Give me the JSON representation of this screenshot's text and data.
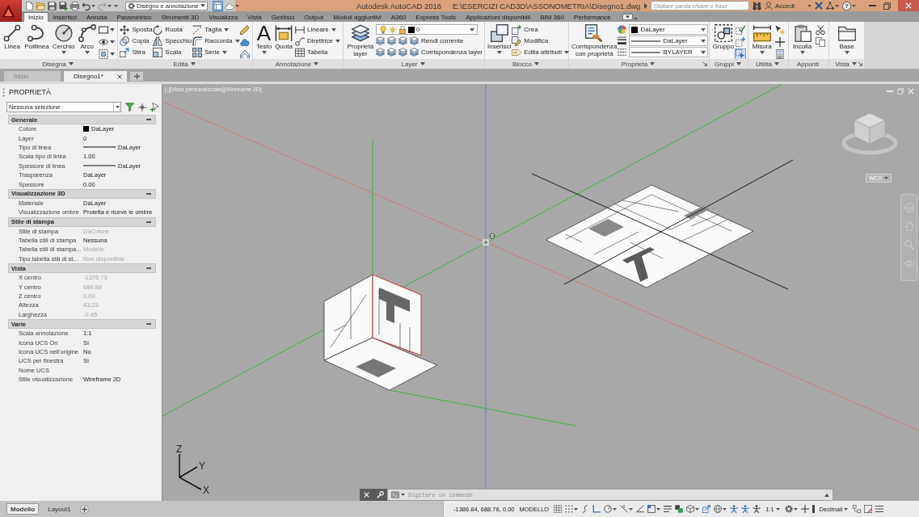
{
  "title_bar": {
    "workspace": "Disegno e annotazione",
    "app_name": "Autodesk AutoCAD 2016",
    "file_path": "E:\\ESERCIZI CAD3D\\ASSONOMETRIA\\Disegno1.dwg",
    "search": {
      "placeholder": "Digitare parola chiave o frase"
    },
    "user": "Accedi",
    "help_glyph": "?"
  },
  "ribbon": {
    "tabs": [
      {
        "label": "Inizio",
        "selected": true
      },
      {
        "label": "Inserisci",
        "selected": false
      },
      {
        "label": "Annota",
        "selected": false
      },
      {
        "label": "Parametrico",
        "selected": false
      },
      {
        "label": "Strumenti 3D",
        "selected": false
      },
      {
        "label": "Visualizza",
        "selected": false
      },
      {
        "label": "Vista",
        "selected": false
      },
      {
        "label": "Gestisci",
        "selected": false
      },
      {
        "label": "Output",
        "selected": false
      },
      {
        "label": "Moduli aggiuntivi",
        "selected": false
      },
      {
        "label": "A360",
        "selected": false
      },
      {
        "label": "Express Tools",
        "selected": false
      },
      {
        "label": "Applicazioni disponibili",
        "selected": false
      },
      {
        "label": "BIM 360",
        "selected": false
      },
      {
        "label": "Performance",
        "selected": false
      }
    ],
    "panels": [
      {
        "title": "Disegna",
        "menu": true,
        "launcher": false,
        "columns": [
          {
            "kind": "large",
            "label": "Linea",
            "menu": false
          },
          {
            "kind": "large",
            "label": "Polilinea",
            "menu": false
          },
          {
            "kind": "large",
            "label": "Cerchio",
            "menu": true
          },
          {
            "kind": "large",
            "label": "Arco",
            "menu": true
          },
          {
            "kind": "icons",
            "items": [
              {
                "menu": true,
                "on": false
              },
              {
                "menu": true,
                "on": false
              },
              {
                "menu": true,
                "on": false
              }
            ]
          }
        ]
      },
      {
        "title": "Edita",
        "menu": true,
        "launcher": false,
        "columns": [
          {
            "kind": "stack",
            "items": [
              {
                "label": "Sposta",
                "menu": false
              },
              {
                "label": "Copia",
                "menu": false
              },
              {
                "label": "Stira",
                "menu": false
              }
            ]
          },
          {
            "kind": "stack",
            "items": [
              {
                "label": "Ruota",
                "menu": false
              },
              {
                "label": "Specchio",
                "menu": false
              },
              {
                "label": "Scala",
                "menu": false
              }
            ]
          },
          {
            "kind": "stack",
            "items": [
              {
                "label": "Taglia",
                "menu": true
              },
              {
                "label": "Raccorda",
                "menu": true
              },
              {
                "label": "Serie",
                "menu": true
              }
            ]
          },
          {
            "kind": "icons",
            "items": [
              {
                "menu": false,
                "on": false
              },
              {
                "menu": false,
                "on": false
              },
              {
                "menu": false,
                "on": false
              }
            ]
          }
        ]
      },
      {
        "title": "Annotazione",
        "menu": true,
        "launcher": false,
        "columns": [
          {
            "kind": "large",
            "label": "Testo",
            "glyph": "A",
            "menu": true
          },
          {
            "kind": "large",
            "label": "Quota",
            "menu": false
          },
          {
            "kind": "stack",
            "items": [
              {
                "label": "Lineare",
                "menu": true
              },
              {
                "label": "Direttrice",
                "menu": true
              },
              {
                "label": "Tabella",
                "menu": false
              }
            ]
          }
        ]
      },
      {
        "title": "Layer",
        "menu": true,
        "launcher": false,
        "columns": [
          {
            "kind": "large",
            "label": "Proprietà layer",
            "menu": false
          },
          {
            "kind": "layer",
            "value": "0",
            "rows": [
              {
                "label": "Rendi corrente"
              },
              {
                "label": "Corrispondenza layer"
              }
            ]
          }
        ]
      },
      {
        "title": "Blocco",
        "menu": true,
        "launcher": false,
        "columns": [
          {
            "kind": "large",
            "label": "Inserisci",
            "menu": true
          },
          {
            "kind": "stack",
            "items": [
              {
                "label": "Crea",
                "menu": false
              },
              {
                "label": "Modifica",
                "menu": false
              },
              {
                "label": "Edita attributi",
                "menu": true
              }
            ]
          }
        ]
      },
      {
        "title": "Proprietà",
        "menu": true,
        "launcher": true,
        "columns": [
          {
            "kind": "large",
            "label": "Corrispondenza con proprietà",
            "menu": false
          },
          {
            "kind": "combos",
            "items": [
              {
                "kind": "color",
                "value": "DaLayer"
              },
              {
                "kind": "linetype",
                "value": "DaLayer"
              },
              {
                "kind": "lineweight",
                "value": "BYLAYER"
              }
            ]
          }
        ]
      },
      {
        "title": "Gruppi",
        "menu": true,
        "launcher": false,
        "columns": [
          {
            "kind": "large",
            "label": "Gruppo",
            "menu": false
          },
          {
            "kind": "icons",
            "items": [
              {
                "menu": false,
                "on": false
              },
              {
                "menu": false,
                "on": false
              },
              {
                "menu": false,
                "on": true
              }
            ]
          }
        ]
      },
      {
        "title": "Utilità",
        "menu": true,
        "launcher": false,
        "columns": [
          {
            "kind": "large",
            "label": "Misura",
            "menu": true
          },
          {
            "kind": "icons",
            "items": [
              {
                "menu": false,
                "on": false
              },
              {
                "menu": false,
                "on": false
              },
              {
                "menu": false,
                "on": false
              }
            ]
          }
        ]
      },
      {
        "title": "Appunti",
        "menu": false,
        "launcher": false,
        "columns": [
          {
            "kind": "large",
            "label": "Incolla",
            "menu": true
          },
          {
            "kind": "icons",
            "items": [
              {
                "menu": false,
                "on": false
              },
              {
                "menu": false,
                "on": false
              }
            ]
          }
        ]
      },
      {
        "title": "Vista",
        "menu": true,
        "launcher": true,
        "columns": [
          {
            "kind": "large",
            "label": "Base",
            "menu": true
          }
        ]
      }
    ]
  },
  "file_tabs": [
    {
      "label": "Inizio",
      "selected": false,
      "closable": false
    },
    {
      "label": "Disegno1*",
      "selected": true,
      "closable": true
    }
  ],
  "properties_palette": {
    "title": "PROPRIETÀ",
    "selection": "Nessuna selezione",
    "sections": [
      {
        "title": "Generale",
        "expanded": true,
        "rows": [
          {
            "label": "Colore",
            "kind": "swatch",
            "value": "DaLayer",
            "disabled": false
          },
          {
            "label": "Layer",
            "kind": "text",
            "value": "0",
            "disabled": false
          },
          {
            "label": "Tipo di linea",
            "kind": "line",
            "value": "DaLayer",
            "disabled": false
          },
          {
            "label": "Scala tipo di linea",
            "kind": "text",
            "value": "1.00",
            "disabled": false
          },
          {
            "label": "Spessore di linea",
            "kind": "line",
            "value": "DaLayer",
            "disabled": false
          },
          {
            "label": "Trasparenza",
            "kind": "text",
            "value": "DaLayer",
            "disabled": false
          },
          {
            "label": "Spessore",
            "kind": "text",
            "value": "0.00",
            "disabled": false
          }
        ]
      },
      {
        "title": "Visualizzazione 3D",
        "expanded": true,
        "rows": [
          {
            "label": "Materiale",
            "kind": "text",
            "value": "DaLayer",
            "disabled": false
          },
          {
            "label": "Visualizzazione ombre",
            "kind": "text",
            "value": "Proietta e riceve le ombre",
            "disabled": false
          }
        ]
      },
      {
        "title": "Stile di stampa",
        "expanded": true,
        "rows": [
          {
            "label": "Stile di stampa",
            "kind": "text",
            "value": "DaColore",
            "disabled": true
          },
          {
            "label": "Tabella stili di stampa",
            "kind": "text",
            "value": "Nessuna",
            "disabled": false
          },
          {
            "label": "Tabella stili di stampa...",
            "kind": "text",
            "value": "Modello",
            "disabled": true
          },
          {
            "label": "Tipo tabella stili di st...",
            "kind": "text",
            "value": "Non disponibile",
            "disabled": true
          }
        ]
      },
      {
        "title": "Vista",
        "expanded": true,
        "rows": [
          {
            "label": "X centro",
            "kind": "text",
            "value": "-1375.73",
            "disabled": true
          },
          {
            "label": "Y centro",
            "kind": "text",
            "value": "684.88",
            "disabled": true
          },
          {
            "label": "Z centro",
            "kind": "text",
            "value": "0.00",
            "disabled": true
          },
          {
            "label": "Altezza",
            "kind": "text",
            "value": "43.23",
            "disabled": true
          },
          {
            "label": "Larghezza",
            "kind": "text",
            "value": "-0.45",
            "disabled": true
          }
        ]
      },
      {
        "title": "Varie",
        "expanded": true,
        "rows": [
          {
            "label": "Scala annotazione",
            "kind": "text",
            "value": "1:1",
            "disabled": false
          },
          {
            "label": "Icona UCS On",
            "kind": "text",
            "value": "Sì",
            "disabled": false
          },
          {
            "label": "Icona UCS nell'origine",
            "kind": "text",
            "value": "No",
            "disabled": false
          },
          {
            "label": "UCS per finestra",
            "kind": "text",
            "value": "Sì",
            "disabled": false
          },
          {
            "label": "Nome UCS",
            "kind": "text"
          },
          {
            "label": "Stile visualizzazione",
            "kind": "text",
            "value": "Wireframe 2D",
            "disabled": false
          }
        ]
      }
    ]
  },
  "viewport": {
    "controls": [
      "[-]",
      "[Vista personalizzata]",
      "[Wireframe 2D]"
    ],
    "ucs_menu": "WCS",
    "ucs_axes": [
      "Z",
      "Y",
      "X"
    ]
  },
  "command_line": {
    "placeholder": "Digitare un comando"
  },
  "layout_tabs": [
    {
      "label": "Modello",
      "selected": true
    },
    {
      "label": "Layout1",
      "selected": false
    }
  ],
  "status_bar": {
    "coordinates": "-1386.84, 688.78, 0.00",
    "space": "MODELLO",
    "annotation_scale": "1:1",
    "units": "Decimali"
  }
}
